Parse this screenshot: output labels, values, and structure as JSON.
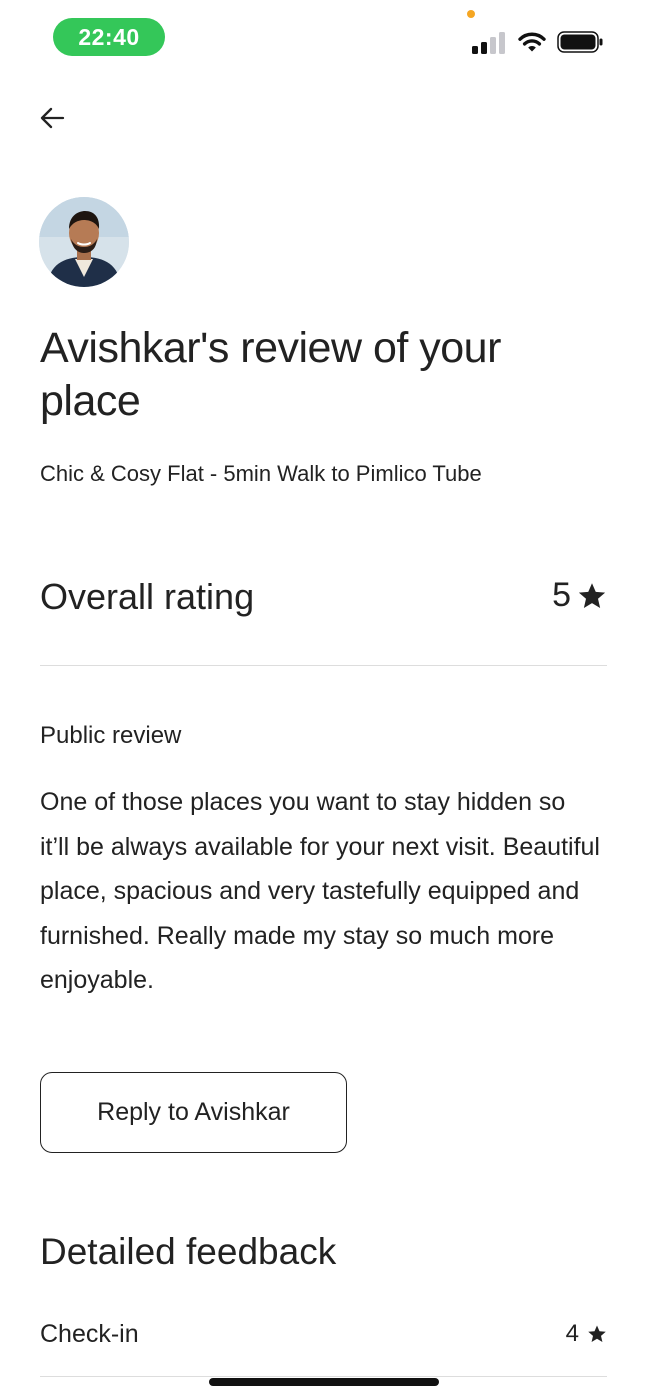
{
  "status_bar": {
    "time": "22:40",
    "signal_icon": "cellular-signal-icon",
    "wifi_icon": "wifi-icon",
    "battery_icon": "battery-icon",
    "accent_color": "#34c759"
  },
  "header": {
    "back_icon": "back-arrow-icon"
  },
  "review": {
    "title": "Avishkar's review of your place",
    "listing": "Chic & Cosy Flat - 5min Walk to Pimlico Tube",
    "overall_rating_label": "Overall rating",
    "overall_rating_value": "5",
    "public_review_label": "Public review",
    "public_review_text": "One of those places you want to stay hidden so it’ll be always available for your next visit. Beautiful place, spacious and very tastefully equipped and furnished. Really made my stay so much more enjoyable.",
    "reply_button": "Reply to Avishkar"
  },
  "detailed_feedback": {
    "title": "Detailed feedback",
    "items": [
      {
        "label": "Check-in",
        "value": "4"
      }
    ]
  }
}
